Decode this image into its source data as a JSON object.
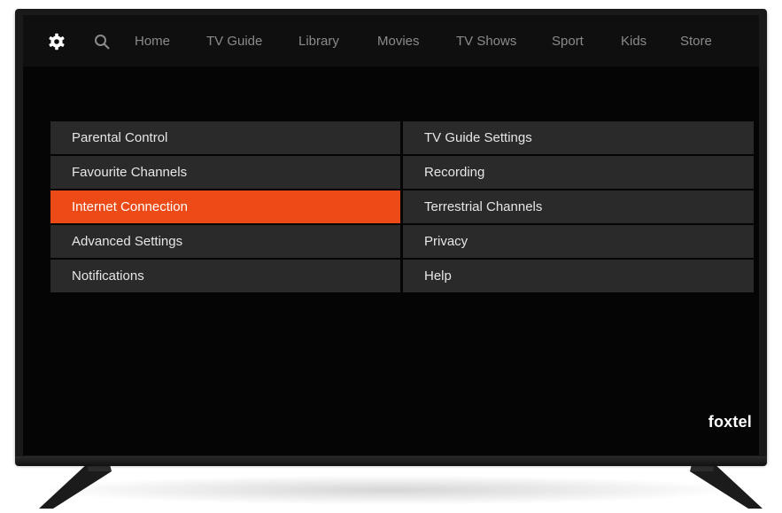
{
  "nav": {
    "items": [
      {
        "label": "Home"
      },
      {
        "label": "TV Guide"
      },
      {
        "label": "Library"
      },
      {
        "label": "Movies"
      },
      {
        "label": "TV Shows"
      },
      {
        "label": "Sport"
      },
      {
        "label": "Kids"
      },
      {
        "label": "Store"
      }
    ],
    "icons": [
      "gear-icon",
      "search-icon"
    ]
  },
  "settings_menu": {
    "left": [
      {
        "label": "Parental Control"
      },
      {
        "label": "Favourite Channels"
      },
      {
        "label": "Internet Connection",
        "selected": true
      },
      {
        "label": "Advanced Settings"
      },
      {
        "label": "Notifications"
      }
    ],
    "right": [
      {
        "label": "TV Guide Settings"
      },
      {
        "label": "Recording"
      },
      {
        "label": "Terrestrial Channels"
      },
      {
        "label": "Privacy"
      },
      {
        "label": "Help"
      }
    ]
  },
  "brand": {
    "logo_text": "foxtel"
  },
  "colors": {
    "accent": "#ec4a16",
    "menu_cell": "#2a2a2a",
    "screen_bg": "#050505",
    "nav_text": "#8a8a8a"
  }
}
